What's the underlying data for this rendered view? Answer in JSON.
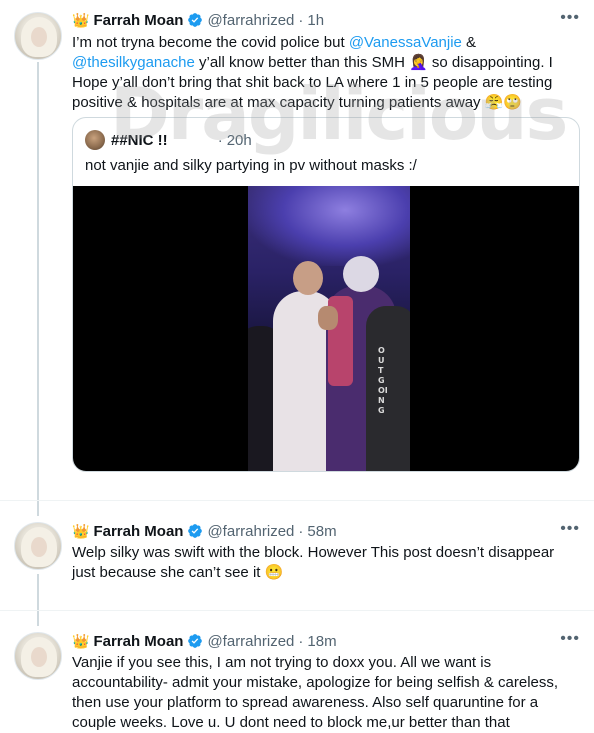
{
  "tweets": [
    {
      "display_name": "Farrah Moan",
      "handle": "@farrahrized",
      "time": "1h",
      "text_parts": [
        "I’m not tryna become the covid police but ",
        "@VanessaVanjie",
        " & ",
        "@thesilkyganache",
        "  y’all know better than this SMH 🤦‍♀️ so disappointing. I Hope y’all don’t bring that shit back to LA where 1 in 5 people are testing positive & hospitals are at max capacity turning patients away 😤🙄"
      ]
    },
    {
      "display_name": "Farrah Moan",
      "handle": "@farrahrized",
      "time": "58m",
      "text": "Welp silky was swift with the block. However This post doesn’t disappear just because she can’t see it 😬"
    },
    {
      "display_name": "Farrah Moan",
      "handle": "@farrahrized",
      "time": "18m",
      "text": "Vanjie if you see this, I am not trying to doxx you. All we want is accountability- admit your mistake, apologize for being selfish & careless, then use your platform to spread awareness. Also self quaruntine for a couple weeks. Love u. U dont need to block me,ur better than that"
    }
  ],
  "quote": {
    "display_name": "##NIC !!",
    "time": "20h",
    "text": "not vanjie and silky partying in pv without masks :/",
    "shirt_text": "OUTGOING"
  },
  "watermark": "Dragilicious",
  "icons": {
    "crown": "👑",
    "verified": "verified-badge-icon",
    "more": "•••",
    "dot": "·"
  },
  "colors": {
    "accent": "#1d9bf0",
    "muted": "#536471",
    "line": "#cfd9de"
  }
}
